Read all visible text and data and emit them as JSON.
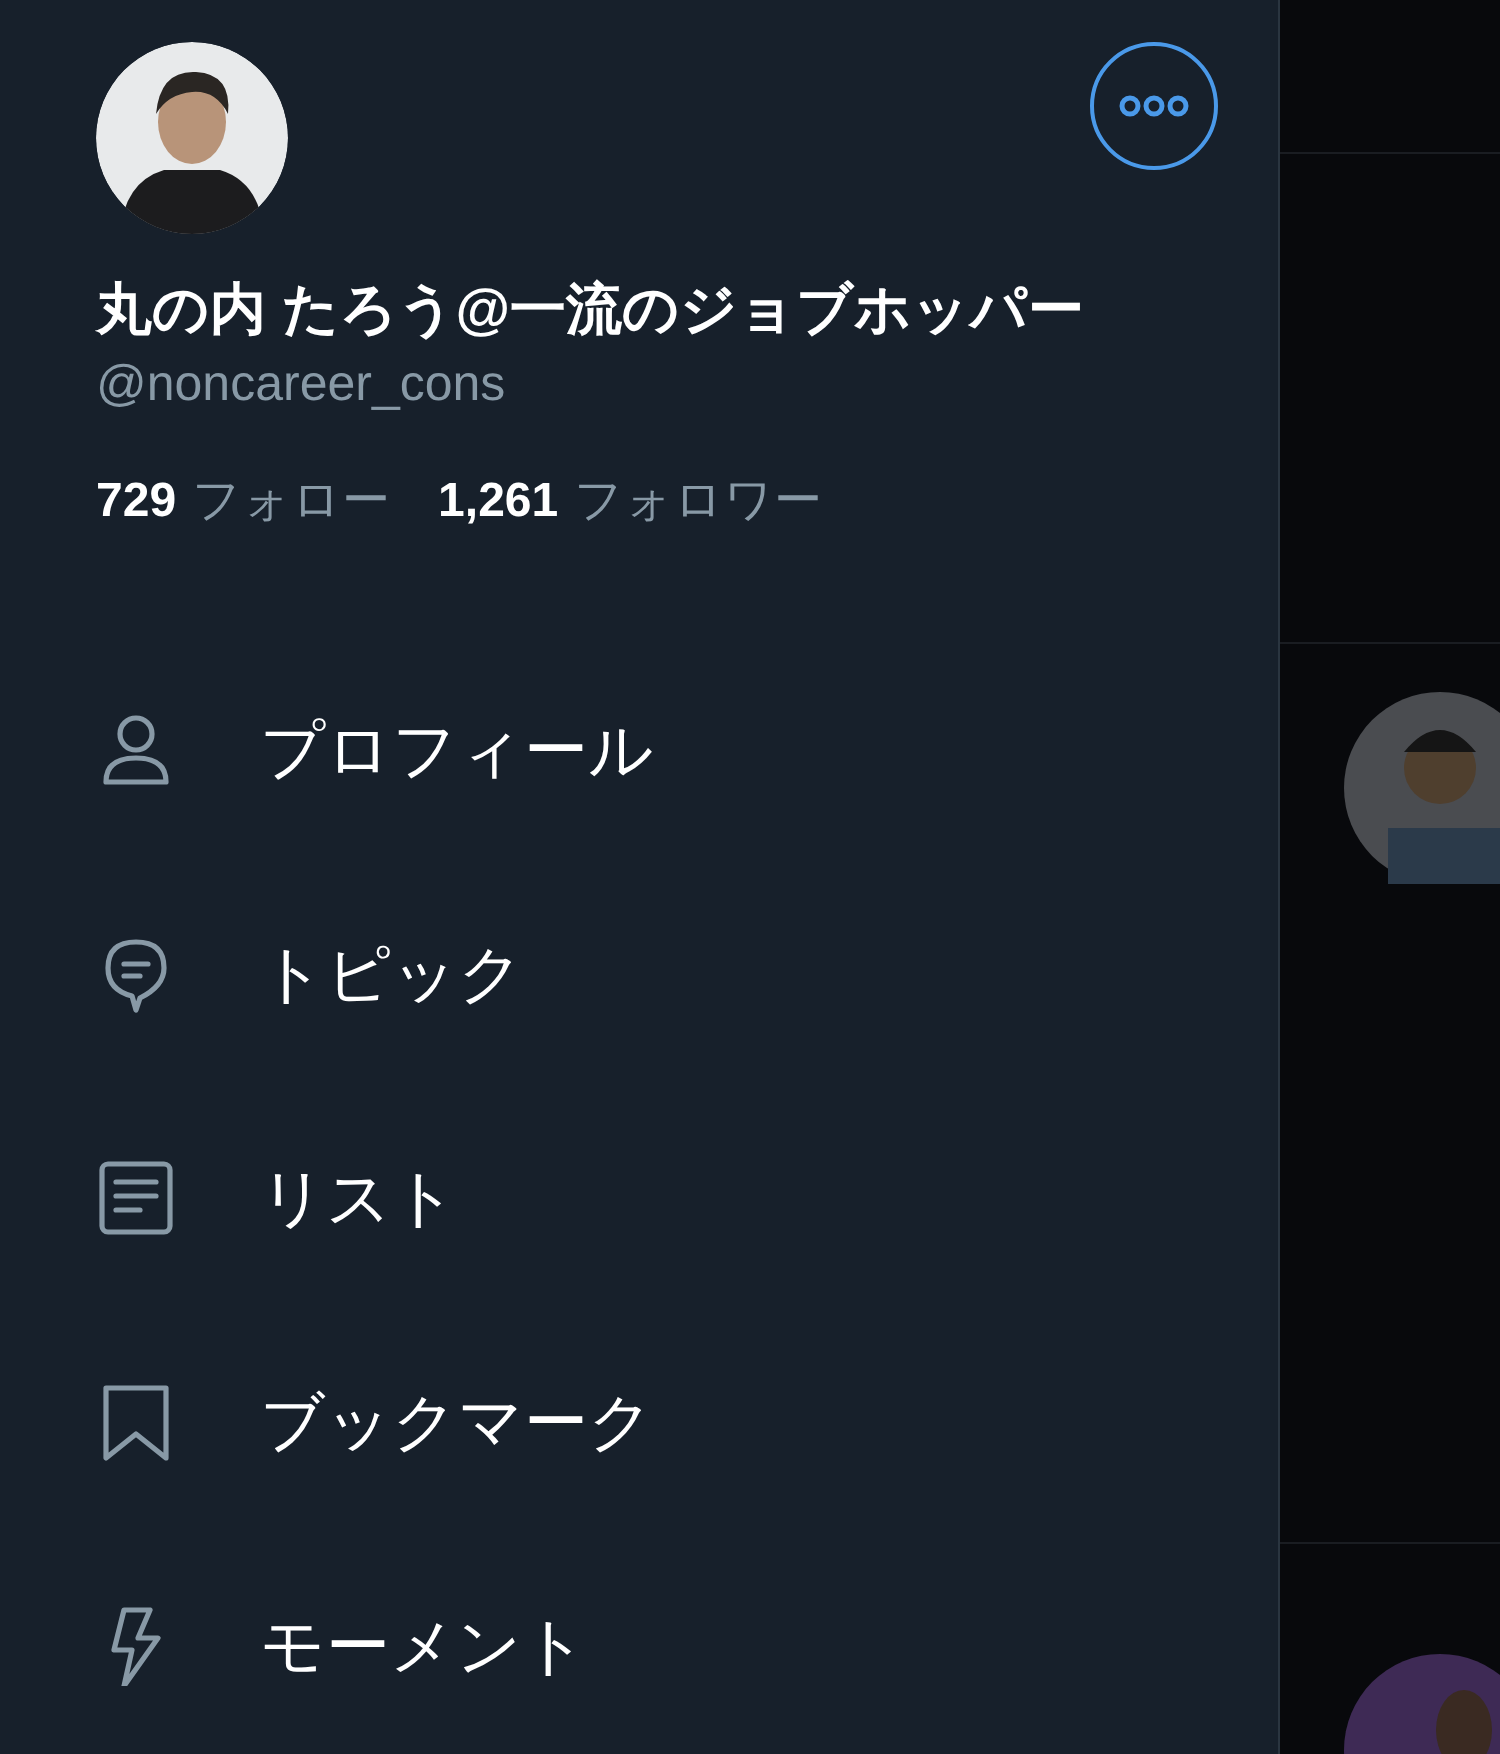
{
  "profile": {
    "name": "丸の内 たろう@一流のジョブホッパー",
    "handle": "@noncareer_cons",
    "following_count": "729",
    "following_label": "フォロー",
    "followers_count": "1,261",
    "followers_label": "フォロワー"
  },
  "menu": [
    {
      "label": "プロフィール"
    },
    {
      "label": "トピック"
    },
    {
      "label": "リスト"
    },
    {
      "label": "ブックマーク"
    },
    {
      "label": "モーメント"
    }
  ]
}
